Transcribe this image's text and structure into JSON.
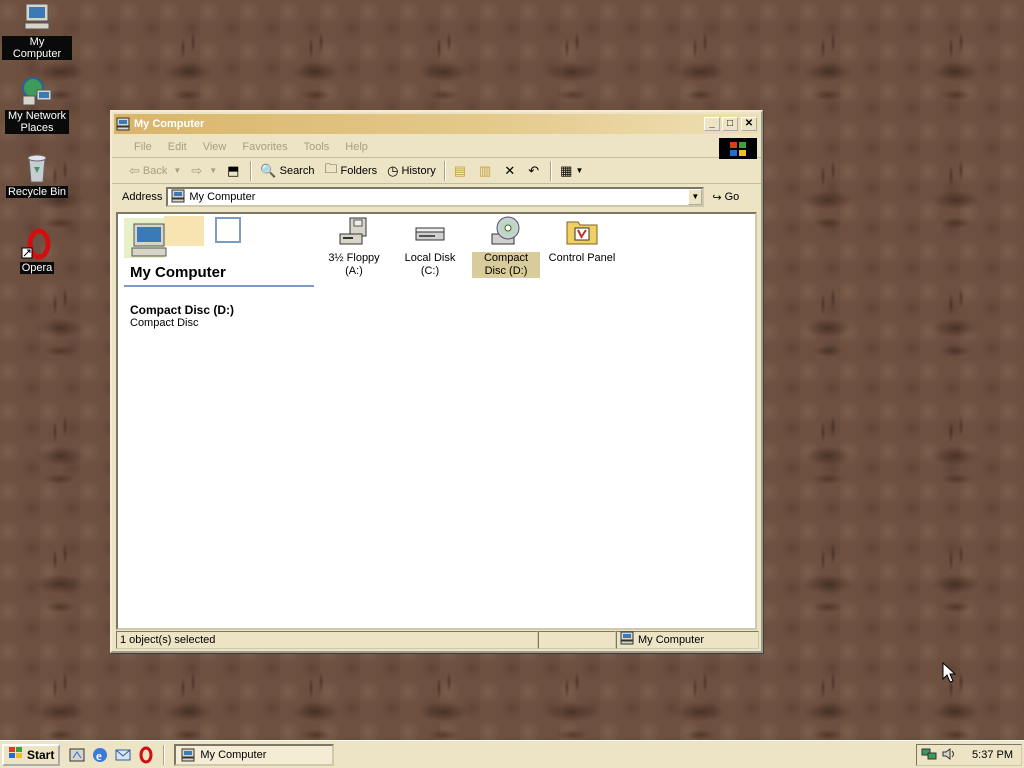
{
  "desktop": {
    "icons": [
      {
        "label": "My Computer",
        "icon": "computer-icon"
      },
      {
        "label": "My Network Places",
        "icon": "network-icon"
      },
      {
        "label": "Recycle Bin",
        "icon": "recycle-bin-icon"
      },
      {
        "label": "Opera",
        "icon": "opera-icon"
      }
    ]
  },
  "window": {
    "title": "My Computer",
    "menu": [
      "File",
      "Edit",
      "View",
      "Favorites",
      "Tools",
      "Help"
    ],
    "toolbar": {
      "back": "Back",
      "search": "Search",
      "folders": "Folders",
      "history": "History"
    },
    "address": {
      "label": "Address",
      "value": "My Computer",
      "go": "Go"
    },
    "left_pane": {
      "title": "My Computer",
      "selected_name": "Compact Disc (D:)",
      "selected_type": "Compact Disc"
    },
    "items": [
      {
        "label": "3½ Floppy (A:)",
        "icon": "floppy-drive-icon",
        "selected": false
      },
      {
        "label": "Local Disk (C:)",
        "icon": "hard-disk-icon",
        "selected": false
      },
      {
        "label": "Compact Disc (D:)",
        "icon": "cd-drive-icon",
        "selected": true
      },
      {
        "label": "Control Panel",
        "icon": "control-panel-icon",
        "selected": false
      }
    ],
    "status": {
      "selection": "1 object(s) selected",
      "zone": "My Computer"
    }
  },
  "taskbar": {
    "start": "Start",
    "task": "My Computer",
    "clock": "5:37 PM"
  },
  "colors": {
    "window_bg": "#ece4c4",
    "titlebar": "#d9b56a",
    "desktop": "#6e5040"
  }
}
